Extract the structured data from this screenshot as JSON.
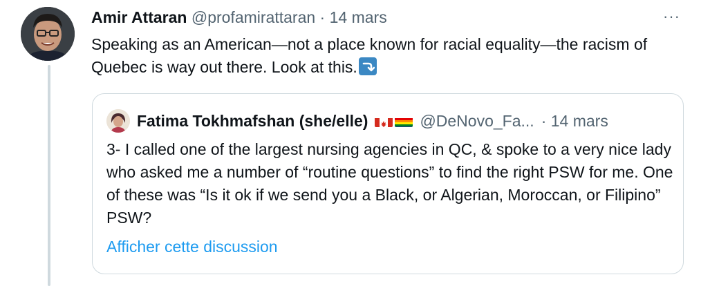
{
  "tweet": {
    "author_name": "Amir Attaran",
    "author_handle": "@profamirattaran",
    "separator": "·",
    "date": "14 mars",
    "more_label": "···",
    "text": "Speaking as an American—not a place known for racial equality—the racism of Quebec is way out there.  Look at this.",
    "emoji": "arrow-right-curving-down-icon"
  },
  "quoted": {
    "author_name": "Fatima Tokhmafshan (she/elle)",
    "flags": [
      "canada-flag-icon",
      "rainbow-flag-icon"
    ],
    "author_handle": "@DeNovo_Fa...",
    "date": "· 14 mars",
    "text": "3- I called one of the largest nursing agencies in QC, & spoke to a very nice lady who asked me a number of “routine questions” to find the right PSW for me. One of these was “Is it ok if we send you a Black, or Algerian, Moroccan, or Filipino” PSW?",
    "link_label": "Afficher cette discussion"
  },
  "colors": {
    "text": "#0f1419",
    "muted": "#536471",
    "link": "#1d9bf0",
    "border": "#cfd9de"
  }
}
